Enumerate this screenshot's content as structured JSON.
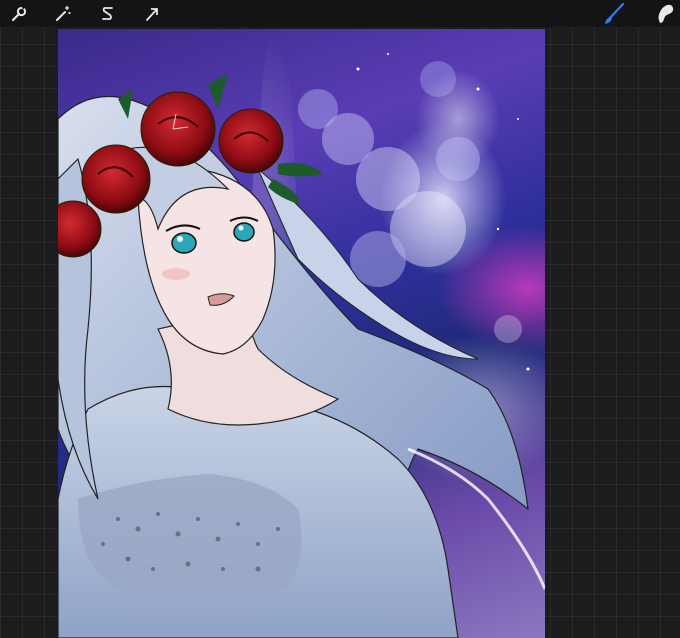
{
  "toolbar": {
    "left_tools": [
      {
        "name": "actions",
        "icon": "wrench-icon"
      },
      {
        "name": "adjustments",
        "icon": "magic-wand-icon"
      },
      {
        "name": "selection",
        "icon": "selection-icon"
      },
      {
        "name": "transform",
        "icon": "arrow-cursor-icon"
      }
    ],
    "right_tools": [
      {
        "name": "brush",
        "icon": "brush-icon",
        "active": true
      },
      {
        "name": "smudge",
        "icon": "smudge-icon"
      }
    ],
    "active_color": "#2f7bf6",
    "icon_color": "#e8e8e8"
  },
  "canvas": {
    "subject": "illustration-of-girl-with-rose-crown"
  }
}
